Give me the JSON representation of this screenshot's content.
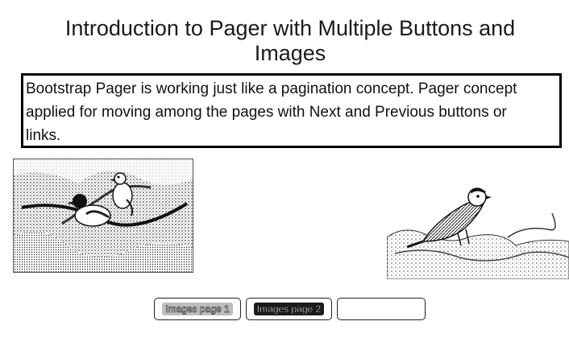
{
  "page": {
    "title": "Introduction to Pager with Multiple Buttons and Images"
  },
  "intro": {
    "lines": [
      "Bootstrap Pager is working just like a pagination concept. Pager concept",
      "applied for moving among the pages with Next and Previous buttons or",
      "links."
    ]
  },
  "images": [
    {
      "name": "birds-on-branch-image",
      "icon": "bird-pair-photo"
    },
    {
      "name": "sparrow-on-rock-image",
      "icon": "sparrow-photo"
    }
  ],
  "pager": {
    "buttons": [
      {
        "label": "Images page 1"
      },
      {
        "label": "Images page 2"
      },
      {
        "label": ""
      }
    ]
  }
}
